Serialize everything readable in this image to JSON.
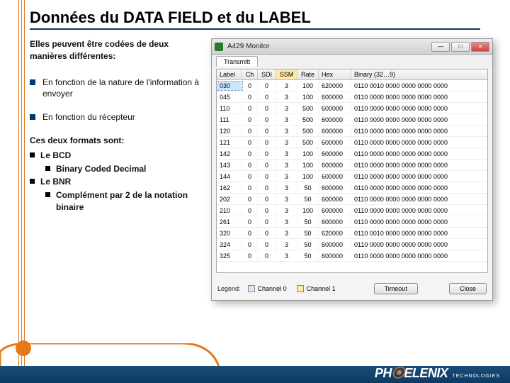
{
  "title": "Données du DATA FIELD et du LABEL",
  "intro": "Elles peuvent être codées de deux manières différentes:",
  "bullets": [
    "En fonction de la nature de l'information à envoyer",
    "En fonction du récepteur"
  ],
  "formats_intro": "Ces deux formats sont:",
  "formats": [
    {
      "name": "Le BCD",
      "sub": "Binary Coded Decimal"
    },
    {
      "name": "Le BNR",
      "sub": "Complément par 2 de la notation binaire"
    }
  ],
  "window": {
    "title": "A429 Monitor",
    "tab": "Transmitt",
    "headers": {
      "label": "Label",
      "ch": "Ch",
      "sdi": "SDI",
      "ssm": "SSM",
      "rate": "Rate",
      "hex": "Hex",
      "bin": "Binary (32…9)"
    },
    "rows": [
      {
        "label": "030",
        "ch": "0",
        "sdi": "0",
        "ssm": "3",
        "rate": "100",
        "hex": "620000",
        "bin": "0110 0010 0000 0000 0000 0000",
        "sel": true
      },
      {
        "label": "045",
        "ch": "0",
        "sdi": "0",
        "ssm": "3",
        "rate": "100",
        "hex": "600000",
        "bin": "0110 0000 0000 0000 0000 0000"
      },
      {
        "label": "110",
        "ch": "0",
        "sdi": "0",
        "ssm": "3",
        "rate": "500",
        "hex": "600000",
        "bin": "0110 0000 0000 0000 0000 0000"
      },
      {
        "label": "111",
        "ch": "0",
        "sdi": "0",
        "ssm": "3",
        "rate": "500",
        "hex": "600000",
        "bin": "0110 0000 0000 0000 0000 0000"
      },
      {
        "label": "120",
        "ch": "0",
        "sdi": "0",
        "ssm": "3",
        "rate": "500",
        "hex": "600000",
        "bin": "0110 0000 0000 0000 0000 0000"
      },
      {
        "label": "121",
        "ch": "0",
        "sdi": "0",
        "ssm": "3",
        "rate": "500",
        "hex": "600000",
        "bin": "0110 0000 0000 0000 0000 0000"
      },
      {
        "label": "142",
        "ch": "0",
        "sdi": "0",
        "ssm": "3",
        "rate": "100",
        "hex": "600000",
        "bin": "0110 0000 0000 0000 0000 0000"
      },
      {
        "label": "143",
        "ch": "0",
        "sdi": "0",
        "ssm": "3",
        "rate": "100",
        "hex": "600000",
        "bin": "0110 0000 0000 0000 0000 0000"
      },
      {
        "label": "144",
        "ch": "0",
        "sdi": "0",
        "ssm": "3",
        "rate": "100",
        "hex": "600000",
        "bin": "0110 0000 0000 0000 0000 0000"
      },
      {
        "label": "162",
        "ch": "0",
        "sdi": "0",
        "ssm": "3",
        "rate": "50",
        "hex": "600000",
        "bin": "0110 0000 0000 0000 0000 0000"
      },
      {
        "label": "202",
        "ch": "0",
        "sdi": "0",
        "ssm": "3",
        "rate": "50",
        "hex": "600000",
        "bin": "0110 0000 0000 0000 0000 0000"
      },
      {
        "label": "210",
        "ch": "0",
        "sdi": "0",
        "ssm": "3",
        "rate": "100",
        "hex": "600000",
        "bin": "0110 0000 0000 0000 0000 0000"
      },
      {
        "label": "261",
        "ch": "0",
        "sdi": "0",
        "ssm": "3",
        "rate": "50",
        "hex": "600000",
        "bin": "0110 0000 0000 0000 0000 0000"
      },
      {
        "label": "320",
        "ch": "0",
        "sdi": "0",
        "ssm": "3",
        "rate": "50",
        "hex": "620000",
        "bin": "0110 0010 0000 0000 0000 0000"
      },
      {
        "label": "324",
        "ch": "0",
        "sdi": "0",
        "ssm": "3",
        "rate": "50",
        "hex": "600000",
        "bin": "0110 0000 0000 0000 0000 0000"
      },
      {
        "label": "325",
        "ch": "0",
        "sdi": "0",
        "ssm": "3",
        "rate": "50",
        "hex": "600000",
        "bin": "0110 0000 0000 0000 0000 0000"
      }
    ],
    "legend": {
      "label": "Legend:",
      "ch0": "Channel 0",
      "ch1": "Channel 1"
    },
    "buttons": {
      "timeout": "Timeout",
      "close": "Close"
    }
  },
  "brand": {
    "name_a": "PH",
    "name_b": "ELENIX",
    "tag": "TECHNOLOGIES"
  }
}
